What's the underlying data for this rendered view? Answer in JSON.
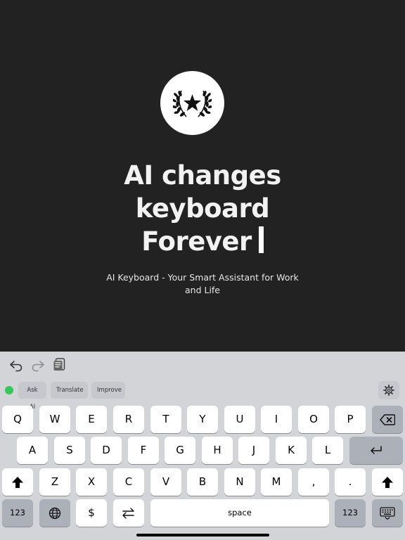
{
  "hero": {
    "headline_line1": "AI changes",
    "headline_line2": "keyboard",
    "headline_line3": "Forever",
    "subtitle": "AI Keyboard - Your Smart Assistant for Work and Life",
    "badge_icon": "laurel-star-icon"
  },
  "edit_bar": {
    "icons": [
      "undo-icon",
      "redo-icon",
      "clipboard-icon"
    ]
  },
  "ai_bar": {
    "chips": [
      "Ask AI",
      "Translate",
      "Improve"
    ],
    "status_color": "#34c759",
    "settings_icon": "gear-icon"
  },
  "keys": {
    "row1": [
      "Q",
      "W",
      "E",
      "R",
      "T",
      "Y",
      "U",
      "I",
      "O",
      "P"
    ],
    "row2": [
      "A",
      "S",
      "D",
      "F",
      "G",
      "H",
      "J",
      "K",
      "L"
    ],
    "row3": [
      "Z",
      "X",
      "C",
      "V",
      "B",
      "N",
      "M",
      ",",
      "."
    ],
    "numbers_label": "123",
    "dollar_label": "$",
    "space_label": "space",
    "numbers_label_right": "123"
  },
  "colors": {
    "hero_background": "#232223",
    "keyboard_background": "#d2d4d8",
    "key_light": "#ffffff",
    "key_dark": "#acb0b8"
  }
}
